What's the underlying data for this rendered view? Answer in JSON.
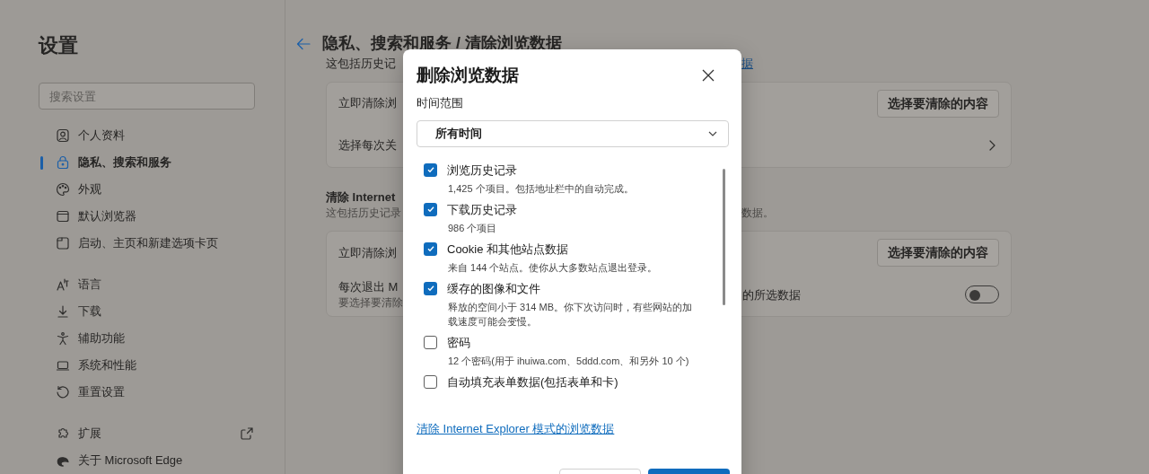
{
  "sidebar": {
    "title": "设置",
    "search": {
      "placeholder": "搜索设置"
    },
    "groups": [
      [
        {
          "label": "个人资料",
          "selected": false
        },
        {
          "label": "隐私、搜索和服务",
          "selected": true
        },
        {
          "label": "外观",
          "selected": false
        },
        {
          "label": "默认浏览器",
          "selected": false
        },
        {
          "label": "启动、主页和新建选项卡页",
          "selected": false
        }
      ],
      [
        {
          "label": "语言",
          "selected": false
        },
        {
          "label": "下载",
          "selected": false
        },
        {
          "label": "辅助功能",
          "selected": false
        },
        {
          "label": "系统和性能",
          "selected": false
        },
        {
          "label": "重置设置",
          "selected": false
        }
      ],
      [
        {
          "label": "扩展",
          "selected": false,
          "external": true
        },
        {
          "label": "关于 Microsoft Edge",
          "selected": false
        }
      ]
    ]
  },
  "page": {
    "title": "隐私、搜索和服务 / 清除浏览数据",
    "intro": {
      "text": "这包括历史记",
      "link": "据"
    },
    "sections": [
      {
        "rows": [
          {
            "label": "立即清除浏",
            "button": "选择要清除的内容"
          },
          {
            "label": "选择每次关",
            "kind": "chevron"
          }
        ]
      },
      {
        "heading": "清除 Internet",
        "description": "这包括历史记录",
        "description_end": "数据。",
        "rows": [
          {
            "label": "立即清除浏",
            "button": "选择要清除的内容"
          },
          {
            "label": "每次退出 M",
            "sublabel": "要选择要清除",
            "label_end": "的所选数据",
            "kind": "toggle",
            "on": false
          }
        ]
      }
    ]
  },
  "dialog": {
    "title": "删除浏览数据",
    "time_range": {
      "label": "时间范围",
      "value": "所有时间"
    },
    "items": [
      {
        "label": "浏览历史记录",
        "description": "1,425 个项目。包括地址栏中的自动完成。",
        "checked": true
      },
      {
        "label": "下载历史记录",
        "description": "986 个项目",
        "checked": true
      },
      {
        "label": "Cookie 和其他站点数据",
        "description": "来自 144 个站点。使你从大多数站点退出登录。",
        "checked": true
      },
      {
        "label": "缓存的图像和文件",
        "description": "释放的空间小于 314 MB。你下次访问时，有些网站的加载速度可能会变慢。",
        "checked": true
      },
      {
        "label": "密码",
        "description": "12 个密码(用于 ihuiwa.com、5ddd.com、和另外 10 个)",
        "checked": false
      },
      {
        "label": "自动填充表单数据(包括表单和卡)",
        "checked": false
      }
    ],
    "link": "清除 Internet Explorer 模式的浏览数据",
    "footer_buttons": [
      {
        "kind": "secondary"
      },
      {
        "kind": "primary"
      }
    ]
  }
}
